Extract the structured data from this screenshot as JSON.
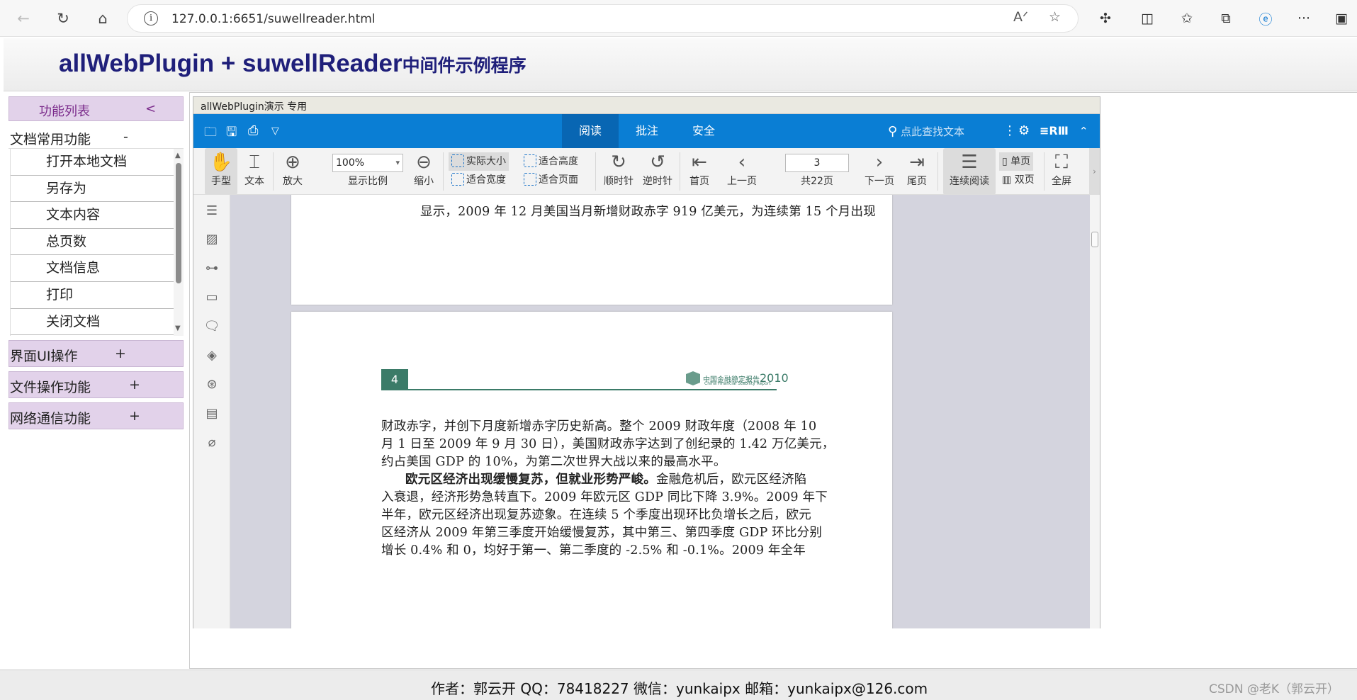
{
  "browser": {
    "url": "127.0.0.1:6651/suwellreader.html"
  },
  "header": {
    "title_main": "allWebPlugin + suwellReader",
    "title_sub": "中间件示例程序"
  },
  "sidebar": {
    "head_label": "功能列表",
    "head_arrow": "<",
    "group_label": "文档常用功能",
    "group_sign": "-",
    "items": [
      "打开本地文档",
      "另存为",
      "文本内容",
      "总页数",
      "文档信息",
      "打印",
      "关闭文档"
    ],
    "categories": [
      {
        "label": "界面UI操作",
        "sign": "+"
      },
      {
        "label": "文件操作功能",
        "sign": "+"
      },
      {
        "label": "网络通信功能",
        "sign": "+"
      }
    ]
  },
  "viewer": {
    "title": "allWebPlugin演示 专用",
    "tabs": [
      "阅读",
      "批注",
      "安全"
    ],
    "search_placeholder": "点此查找文本",
    "brand": "≡RⅢ",
    "toolbar": {
      "hand": "手型",
      "text": "文本",
      "zoom_in": "放大",
      "zoom_value": "100%",
      "zoom_ratio": "显示比例",
      "zoom_out": "缩小",
      "actual_size": "实际大小",
      "fit_width": "适合宽度",
      "fit_height": "适合高度",
      "fit_page": "适合页面",
      "rotate_cw": "顺时针",
      "rotate_ccw": "逆时针",
      "first": "首页",
      "prev": "上一页",
      "page_value": "3",
      "total": "共22页",
      "next": "下一页",
      "last": "尾页",
      "continuous": "连续阅读",
      "single": "单页",
      "double": "双页",
      "fullscreen": "全屏"
    },
    "page3_line": "显示，2009 年 12 月美国当月新增财政赤字 919 亿美元，为连续第 15 个月出现",
    "page4": {
      "number": "4",
      "logo_text": "中国金融稳定报告",
      "logo_year": "2010",
      "logo_sub": "China Financial Stability Report",
      "lines": [
        "财政赤字，并创下月度新增赤字历史新高。整个 2009 财政年度（2008 年 10",
        "月 1 日至 2009 年 9 月 30 日），美国财政赤字达到了创纪录的 1.42 万亿美元，",
        "约占美国 GDP 的 10%，为第二次世界大战以来的最高水平。",
        "入衰退，经济形势急转直下。2009 年欧元区 GDP 同比下降 3.9%。2009 年下",
        "半年，欧元区经济出现复苏迹象。在连续 5 个季度出现环比负增长之后，欧元",
        "区经济从 2009 年第三季度开始缓慢复苏，其中第三、第四季度 GDP 环比分别",
        "增长 0.4% 和 0，均好于第一、第二季度的 -2.5% 和 -0.1%。2009 年全年"
      ],
      "para_bold": "欧元区经济出现缓慢复苏，但就业形势严峻。",
      "para_rest": "金融危机后，欧元区经济陷"
    }
  },
  "footer": {
    "credits": "作者：郭云开 QQ：78418227 微信：yunkaipx 邮箱：yunkaipx@126.com",
    "watermark": "CSDN @老K（郭云开）"
  }
}
